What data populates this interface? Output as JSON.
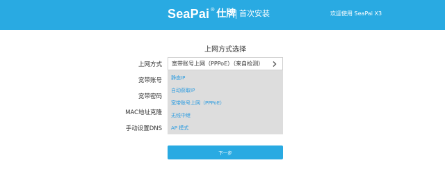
{
  "header": {
    "logo_text": "SeaPai",
    "logo_reg": "®",
    "logo_cn": "仕牌",
    "subtitle": "首次安装",
    "welcome": "欢迎使用 SeaPai X3"
  },
  "page_title": "上网方式选择",
  "form": {
    "labels": [
      "上网方式",
      "宽带账号",
      "宽带密码",
      "MAC地址克隆",
      "手动设置DNS"
    ],
    "select": {
      "value": "宽带账号上网（PPPoE）（来自检测）",
      "icon": "chevron-right-icon"
    },
    "dropdown_options": [
      "静态IP",
      "自动获取IP",
      "宽带账号上网（PPPoE）",
      "无线中继",
      "AP 模式"
    ]
  },
  "next_button_label": "下一步",
  "colors": {
    "accent": "#29aae2",
    "dropdown_bg": "#dddddd",
    "option_text": "#2a9be0"
  }
}
